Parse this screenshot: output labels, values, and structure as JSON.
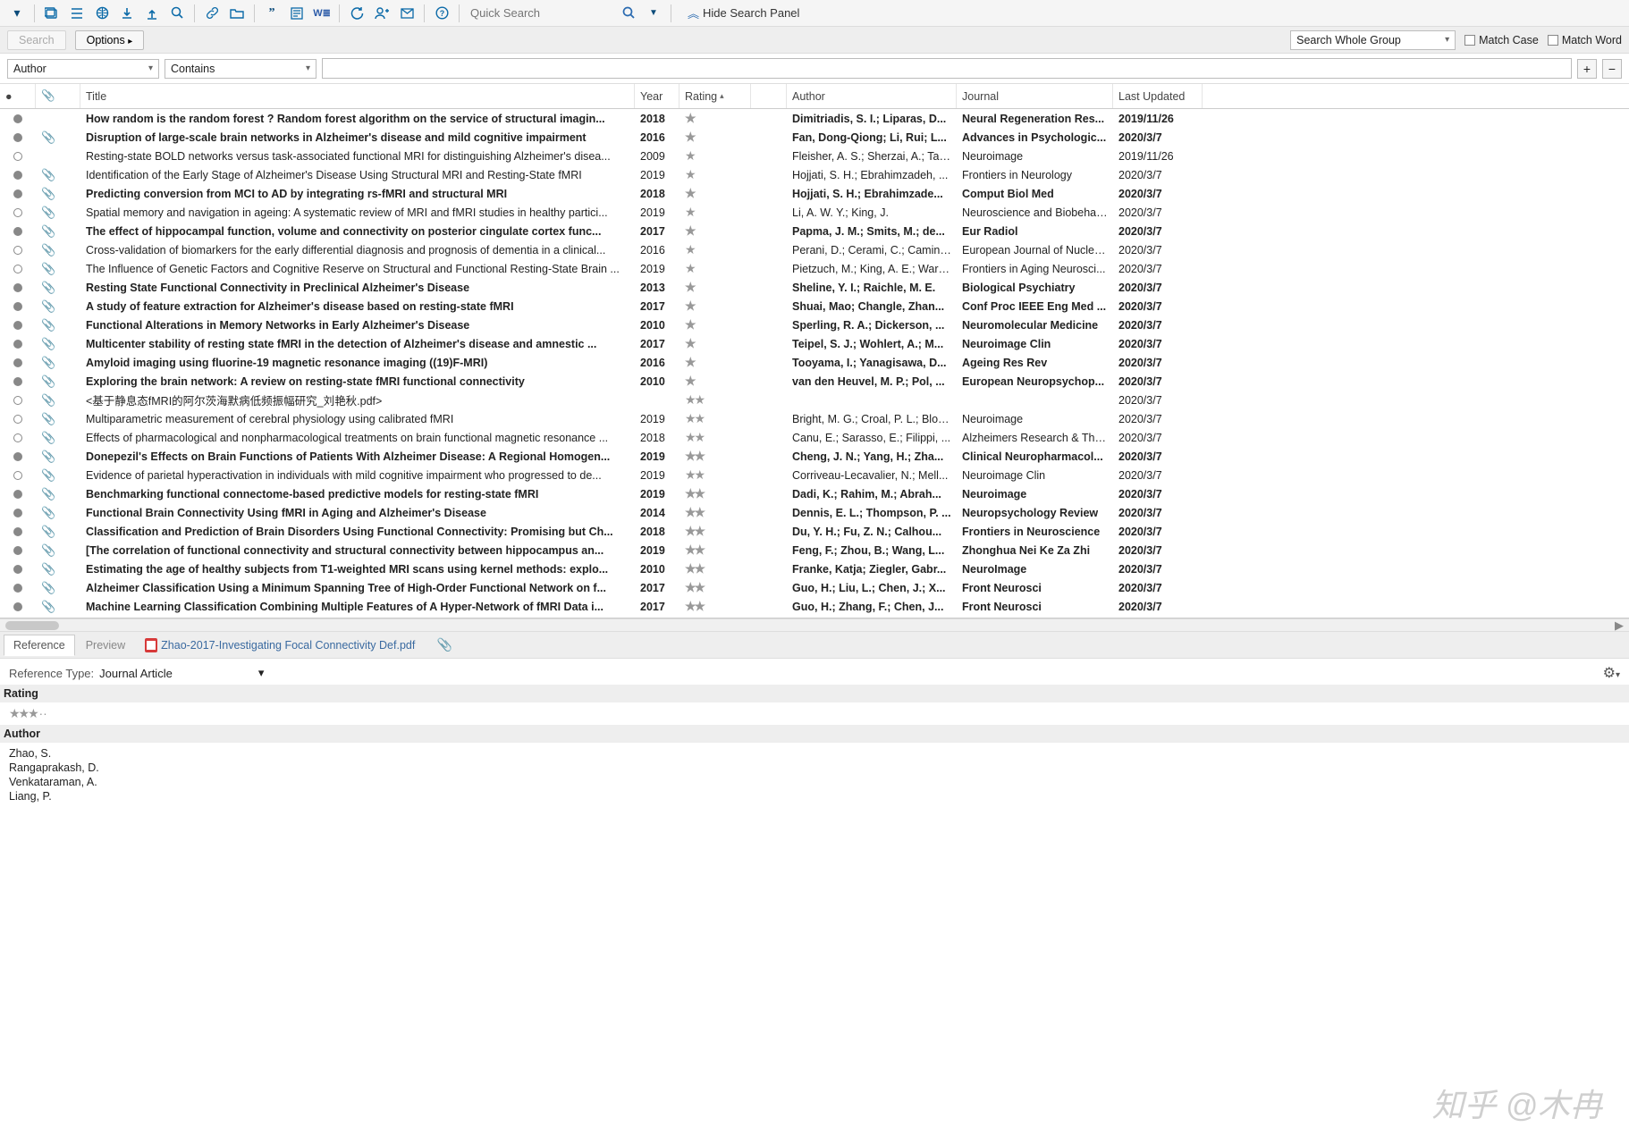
{
  "toolbar": {
    "quick_search_placeholder": "Quick Search",
    "hide_panel": "Hide Search Panel",
    "icons": [
      "dropdown",
      "folder-copy",
      "list",
      "globe",
      "download",
      "upload",
      "find",
      "link",
      "folder-open",
      "quote",
      "note",
      "word-export",
      "sync",
      "add-user",
      "mail",
      "help"
    ]
  },
  "searchbar": {
    "search": "Search",
    "options": "Options",
    "scope": "Search Whole Group",
    "match_case": "Match Case",
    "match_word": "Match Word"
  },
  "filterbar": {
    "field": "Author",
    "op": "Contains",
    "value": ""
  },
  "columns": {
    "title": "Title",
    "year": "Year",
    "rating": "Rating",
    "author": "Author",
    "journal": "Journal",
    "updated": "Last Updated"
  },
  "rows": [
    {
      "read": true,
      "att": false,
      "bold": true,
      "title": "How random is the random forest ? Random forest algorithm on the service of structural imagin...",
      "year": "2018",
      "rating": 1,
      "author": "Dimitriadis, S. I.; Liparas, D...",
      "journal": "Neural Regeneration Res...",
      "updated": "2019/11/26"
    },
    {
      "read": true,
      "att": true,
      "bold": true,
      "title": "Disruption of large-scale brain networks in Alzheimer's disease and mild cognitive impairment",
      "year": "2016",
      "rating": 1,
      "author": "Fan, Dong-Qiong; Li, Rui; L...",
      "journal": "Advances in Psychologic...",
      "updated": "2020/3/7"
    },
    {
      "read": false,
      "att": false,
      "bold": false,
      "title": "Resting-state BOLD networks versus task-associated functional MRI for distinguishing Alzheimer's disea...",
      "year": "2009",
      "rating": 1,
      "author": "Fleisher, A. S.; Sherzai, A.; Tayl...",
      "journal": "Neuroimage",
      "updated": "2019/11/26"
    },
    {
      "read": true,
      "att": true,
      "bold": false,
      "title": "Identification of the Early Stage of Alzheimer's Disease Using Structural MRI and Resting-State fMRI",
      "year": "2019",
      "rating": 1,
      "author": "Hojjati, S. H.; Ebrahimzadeh, ...",
      "journal": "Frontiers in Neurology",
      "updated": "2020/3/7"
    },
    {
      "read": true,
      "att": true,
      "bold": true,
      "title": "Predicting conversion from MCI to AD by integrating rs-fMRI and structural MRI",
      "year": "2018",
      "rating": 1,
      "author": "Hojjati, S. H.; Ebrahimzade...",
      "journal": "Comput Biol Med",
      "updated": "2020/3/7"
    },
    {
      "read": false,
      "att": true,
      "bold": false,
      "title": "Spatial memory and navigation in ageing: A systematic review of MRI and fMRI studies in healthy partici...",
      "year": "2019",
      "rating": 1,
      "author": "Li, A. W. Y.; King, J.",
      "journal": "Neuroscience and Biobehav...",
      "updated": "2020/3/7"
    },
    {
      "read": true,
      "att": true,
      "bold": true,
      "title": "The effect of hippocampal function, volume and connectivity on posterior cingulate cortex func...",
      "year": "2017",
      "rating": 1,
      "author": "Papma, J. M.; Smits, M.; de...",
      "journal": "Eur Radiol",
      "updated": "2020/3/7"
    },
    {
      "read": false,
      "att": true,
      "bold": false,
      "title": "Cross-validation of biomarkers for the early differential diagnosis and prognosis of dementia in a clinical...",
      "year": "2016",
      "rating": 1,
      "author": "Perani, D.; Cerami, C.; Caminit...",
      "journal": "European Journal of Nuclea...",
      "updated": "2020/3/7"
    },
    {
      "read": false,
      "att": true,
      "bold": false,
      "title": "The Influence of Genetic Factors and Cognitive Reserve on Structural and Functional Resting-State Brain ...",
      "year": "2019",
      "rating": 1,
      "author": "Pietzuch, M.; King, A. E.; Ward...",
      "journal": "Frontiers in Aging Neurosci...",
      "updated": "2020/3/7"
    },
    {
      "read": true,
      "att": true,
      "bold": true,
      "title": "Resting State Functional Connectivity in Preclinical Alzheimer's Disease",
      "year": "2013",
      "rating": 1,
      "author": "Sheline, Y. I.; Raichle, M. E.",
      "journal": "Biological Psychiatry",
      "updated": "2020/3/7"
    },
    {
      "read": true,
      "att": true,
      "bold": true,
      "title": "A study of feature extraction for Alzheimer's disease based on resting-state fMRI",
      "year": "2017",
      "rating": 1,
      "author": "Shuai, Mao; Changle, Zhan...",
      "journal": "Conf Proc IEEE Eng Med ...",
      "updated": "2020/3/7"
    },
    {
      "read": true,
      "att": true,
      "bold": true,
      "title": "Functional Alterations in Memory Networks in Early Alzheimer's Disease",
      "year": "2010",
      "rating": 1,
      "author": "Sperling, R. A.; Dickerson, ...",
      "journal": "Neuromolecular Medicine",
      "updated": "2020/3/7"
    },
    {
      "read": true,
      "att": true,
      "bold": true,
      "title": "Multicenter stability of resting state fMRI in the detection of Alzheimer's disease and amnestic ...",
      "year": "2017",
      "rating": 1,
      "author": "Teipel, S. J.; Wohlert, A.; M...",
      "journal": "Neuroimage Clin",
      "updated": "2020/3/7"
    },
    {
      "read": true,
      "att": true,
      "bold": true,
      "title": "Amyloid imaging using fluorine-19 magnetic resonance imaging ((19)F-MRI)",
      "year": "2016",
      "rating": 1,
      "author": "Tooyama, I.; Yanagisawa, D...",
      "journal": "Ageing Res Rev",
      "updated": "2020/3/7"
    },
    {
      "read": true,
      "att": true,
      "bold": true,
      "title": "Exploring the brain network: A review on resting-state fMRI functional connectivity",
      "year": "2010",
      "rating": 1,
      "author": "van den Heuvel, M. P.; Pol, ...",
      "journal": "European Neuropsychop...",
      "updated": "2020/3/7"
    },
    {
      "read": false,
      "att": true,
      "bold": false,
      "title": "<基于静息态fMRI的阿尔茨海默病低频振幅研究_刘艳秋.pdf>",
      "year": "",
      "rating": 2,
      "author": "",
      "journal": "",
      "updated": "2020/3/7"
    },
    {
      "read": false,
      "att": true,
      "bold": false,
      "title": "Multiparametric measurement of cerebral physiology using calibrated fMRI",
      "year": "2019",
      "rating": 2,
      "author": "Bright, M. G.; Croal, P. L.; Bloc...",
      "journal": "Neuroimage",
      "updated": "2020/3/7"
    },
    {
      "read": false,
      "att": true,
      "bold": false,
      "title": "Effects of pharmacological and nonpharmacological treatments on brain functional magnetic resonance ...",
      "year": "2018",
      "rating": 2,
      "author": "Canu, E.; Sarasso, E.; Filippi, ...",
      "journal": "Alzheimers Research & Ther...",
      "updated": "2020/3/7"
    },
    {
      "read": true,
      "att": true,
      "bold": true,
      "title": "Donepezil's Effects on Brain Functions of Patients With Alzheimer Disease: A Regional Homogen...",
      "year": "2019",
      "rating": 2,
      "author": "Cheng, J. N.; Yang, H.; Zha...",
      "journal": "Clinical Neuropharmacol...",
      "updated": "2020/3/7"
    },
    {
      "read": false,
      "att": true,
      "bold": false,
      "title": "Evidence of parietal hyperactivation in individuals with mild cognitive impairment who progressed to de...",
      "year": "2019",
      "rating": 2,
      "author": "Corriveau-Lecavalier, N.; Mell...",
      "journal": "Neuroimage Clin",
      "updated": "2020/3/7"
    },
    {
      "read": true,
      "att": true,
      "bold": true,
      "title": "Benchmarking functional connectome-based predictive models for resting-state fMRI",
      "year": "2019",
      "rating": 2,
      "author": "Dadi, K.; Rahim, M.; Abrah...",
      "journal": "Neuroimage",
      "updated": "2020/3/7"
    },
    {
      "read": true,
      "att": true,
      "bold": true,
      "title": "Functional Brain Connectivity Using fMRI in Aging and Alzheimer's Disease",
      "year": "2014",
      "rating": 2,
      "author": "Dennis, E. L.; Thompson, P. ...",
      "journal": "Neuropsychology Review",
      "updated": "2020/3/7"
    },
    {
      "read": true,
      "att": true,
      "bold": true,
      "title": "Classification and Prediction of Brain Disorders Using Functional Connectivity: Promising but Ch...",
      "year": "2018",
      "rating": 2,
      "author": "Du, Y. H.; Fu, Z. N.; Calhou...",
      "journal": "Frontiers in Neuroscience",
      "updated": "2020/3/7"
    },
    {
      "read": true,
      "att": true,
      "bold": true,
      "title": "[The correlation of functional connectivity and structural connectivity between hippocampus an...",
      "year": "2019",
      "rating": 2,
      "author": "Feng, F.; Zhou, B.; Wang, L...",
      "journal": "Zhonghua Nei Ke Za Zhi",
      "updated": "2020/3/7"
    },
    {
      "read": true,
      "att": true,
      "bold": true,
      "title": "Estimating the age of healthy subjects from T1-weighted MRI scans using kernel methods: explo...",
      "year": "2010",
      "rating": 2,
      "author": "Franke, Katja; Ziegler, Gabr...",
      "journal": "NeuroImage",
      "updated": "2020/3/7"
    },
    {
      "read": true,
      "att": true,
      "bold": true,
      "title": "Alzheimer Classification Using a Minimum Spanning Tree of High-Order Functional Network on f...",
      "year": "2017",
      "rating": 2,
      "author": "Guo, H.; Liu, L.; Chen, J.; X...",
      "journal": "Front Neurosci",
      "updated": "2020/3/7"
    },
    {
      "read": true,
      "att": true,
      "bold": true,
      "title": "Machine Learning Classification Combining Multiple Features of A Hyper-Network of fMRI Data i...",
      "year": "2017",
      "rating": 2,
      "author": "Guo, H.; Zhang, F.; Chen, J...",
      "journal": "Front Neurosci",
      "updated": "2020/3/7"
    }
  ],
  "tabs": {
    "reference": "Reference",
    "preview": "Preview",
    "file": "Zhao-2017-Investigating Focal Connectivity Def.pdf"
  },
  "detail": {
    "type_label": "Reference Type:",
    "type_value": "Journal Article",
    "rating_label": "Rating",
    "rating_value": 3,
    "author_label": "Author",
    "authors": [
      "Zhao, S.",
      "Rangaprakash, D.",
      "Venkataraman, A.",
      "Liang, P."
    ]
  },
  "watermark": "知乎 @木冉"
}
